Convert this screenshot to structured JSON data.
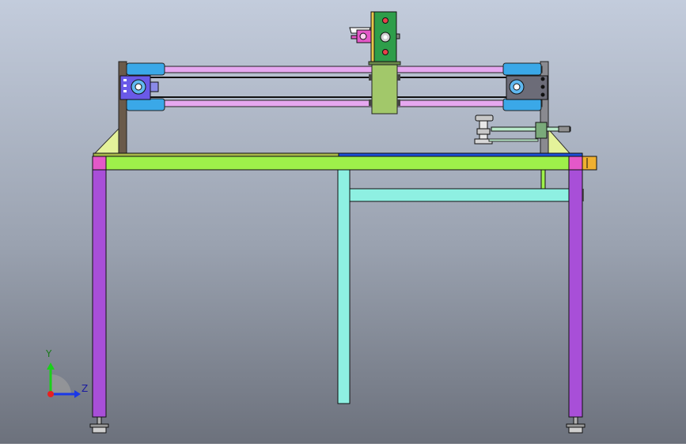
{
  "viewport": {
    "background_top": "#bcc7d8",
    "background_bottom": "#6e7480",
    "triad": {
      "y_label": "Y",
      "z_label": "Z"
    }
  },
  "colors": {
    "table_leg": "#a84fd8",
    "table_top": "#9ef04a",
    "table_top_edge": "#3c3c3c",
    "crossbar": "#8ef0e2",
    "rail": "#e6a8f0",
    "rail_sleeve": "#3aa8e8",
    "end_plate": "#6a5a4a",
    "carriage_green": "#2e9e4a",
    "carriage_olive": "#a2c86a",
    "gusset": "#e4f29a",
    "bearing_block_blue": "#6a5ae8",
    "bearing_block_grey": "#6c6c78",
    "foot": "#9a9a9a",
    "blue_strip": "#1e50d8",
    "olive_strip": "#a8b84a",
    "orange_tab": "#f0b030"
  }
}
